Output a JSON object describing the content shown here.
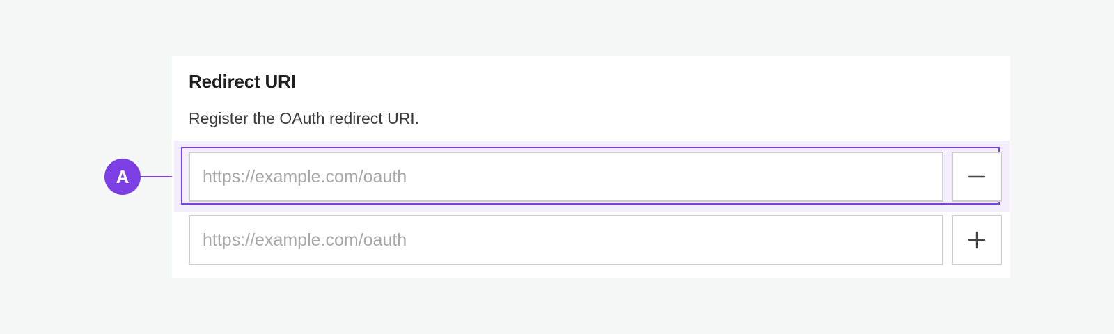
{
  "section": {
    "title": "Redirect URI",
    "description": "Register the OAuth redirect URI."
  },
  "uri_rows": [
    {
      "value": "",
      "placeholder": "https://example.com/oauth",
      "action_icon": "minus-icon",
      "highlighted": true
    },
    {
      "value": "",
      "placeholder": "https://example.com/oauth",
      "action_icon": "plus-icon",
      "highlighted": false
    }
  ],
  "callout": {
    "label": "A",
    "color": "#7b3fe4",
    "highlight_fill": "#f2eefc"
  }
}
